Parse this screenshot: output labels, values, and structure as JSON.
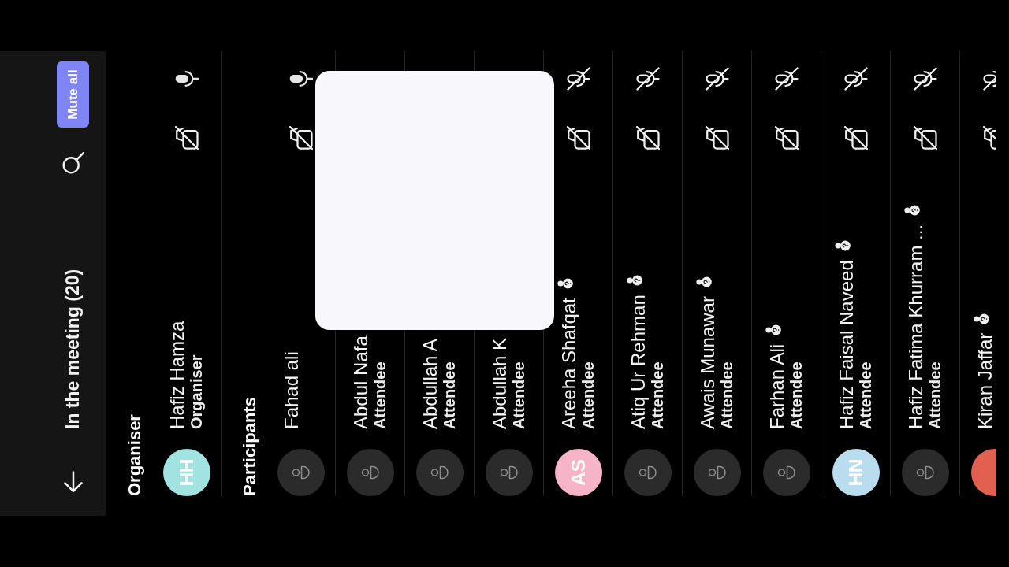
{
  "header": {
    "title": "In the meeting (20)",
    "button": "Mute all"
  },
  "sections": [
    {
      "heading": "Organiser",
      "people": [
        {
          "name": "Hafiz Hamza",
          "role": "Organiser",
          "avatar": {
            "kind": "initials",
            "initials": "HH",
            "color": "#a0e3e0"
          },
          "unverified": false,
          "muted": false,
          "camera_on": false
        }
      ]
    },
    {
      "heading": "Participants",
      "people": [
        {
          "name": "Fahad ali",
          "avatar": {
            "kind": "placeholder"
          },
          "unverified": false,
          "muted": false,
          "camera_on": false
        },
        {
          "name": "Abdul Nafa",
          "role": "Attendee",
          "avatar": {
            "kind": "placeholder"
          }
        },
        {
          "name": "Abdullah A",
          "role": "Attendee",
          "avatar": {
            "kind": "placeholder"
          }
        },
        {
          "name": "Abdullah K",
          "role": "Attendee",
          "avatar": {
            "kind": "placeholder"
          }
        },
        {
          "name": "Areeha Shafqat",
          "role": "Attendee",
          "avatar": {
            "kind": "initials",
            "initials": "AS",
            "color": "#f5b4c7"
          },
          "unverified": true,
          "muted": true,
          "camera_on": false
        },
        {
          "name": "Atiq Ur Rehman",
          "role": "Attendee",
          "avatar": {
            "kind": "placeholder"
          },
          "unverified": true,
          "muted": true,
          "camera_on": false
        },
        {
          "name": "Awais Munawar",
          "role": "Attendee",
          "avatar": {
            "kind": "placeholder"
          },
          "unverified": true,
          "muted": true,
          "camera_on": false
        },
        {
          "name": "Farhan Ali",
          "role": "Attendee",
          "avatar": {
            "kind": "placeholder"
          },
          "unverified": true,
          "muted": true,
          "camera_on": false
        },
        {
          "name": "Hafiz Faisal Naveed",
          "role": "Attendee",
          "avatar": {
            "kind": "initials",
            "initials": "HN",
            "color": "#badcef"
          },
          "unverified": true,
          "muted": true,
          "camera_on": false
        },
        {
          "name": "Hafiz Fatima Khurram ...",
          "role": "Attendee",
          "avatar": {
            "kind": "placeholder"
          },
          "unverified": true,
          "muted": true,
          "camera_on": false
        },
        {
          "name": "Kiran Jaffar",
          "avatar": {
            "kind": "initials",
            "color": "#e2604f"
          },
          "unverified": true,
          "muted": true,
          "camera_on": false
        }
      ]
    }
  ],
  "overlay": {
    "kind": "blank-card"
  }
}
